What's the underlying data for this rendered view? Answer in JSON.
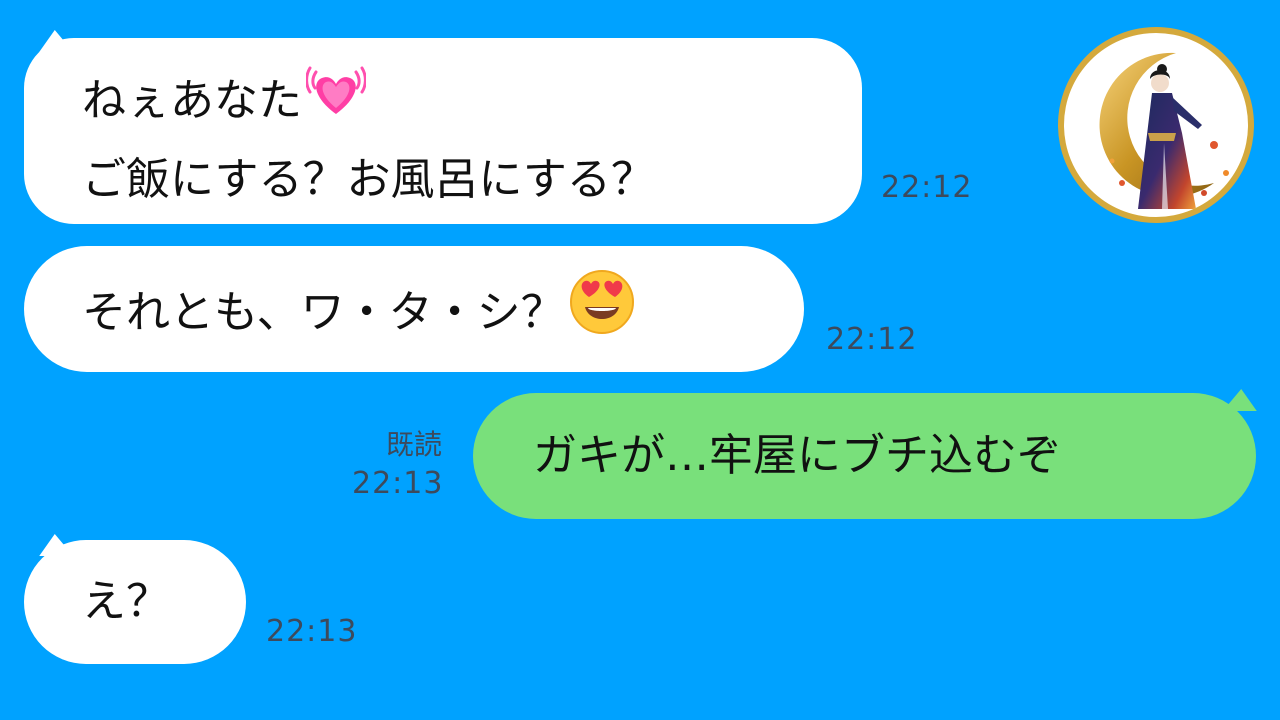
{
  "messages": [
    {
      "from": "other",
      "line1": "ねぇあなた",
      "line1_emoji": "growing-heart",
      "line2": "ご飯にする？お風呂にする？",
      "time": "22:12"
    },
    {
      "from": "other",
      "text": "それとも、ワ・タ・シ？",
      "emoji": "heart-eyes-face",
      "time": "22:12"
    },
    {
      "from": "me",
      "text": "ガキが…牢屋にブチ込むぞ",
      "read_label": "既読",
      "time": "22:13"
    },
    {
      "from": "other",
      "text": "え？",
      "time": "22:13"
    }
  ],
  "colors": {
    "background": "#00a2ff",
    "incoming_bubble": "#ffffff",
    "outgoing_bubble": "#79e07b",
    "timestamp": "#3d4a5c",
    "avatar_ring": "#d4a93c"
  },
  "avatar": {
    "icon": "kimono-woman-crescent-moon-avatar"
  }
}
